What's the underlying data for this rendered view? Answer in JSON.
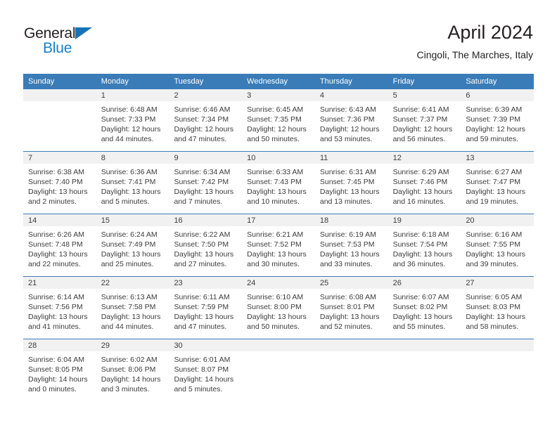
{
  "brand": {
    "word_one": "General",
    "word_two": "Blue",
    "triangle_color": "#1574b8",
    "blue_text_color": "#1b7fc4"
  },
  "header": {
    "title": "April 2024",
    "subtitle": "Cingoli, The Marches, Italy"
  },
  "theme": {
    "header_blue": "#3a7cb8",
    "day_band_gray": "#f1f1f1",
    "text_color": "#3c3c3c"
  },
  "weekdays": [
    "Sunday",
    "Monday",
    "Tuesday",
    "Wednesday",
    "Thursday",
    "Friday",
    "Saturday"
  ],
  "weeks": [
    [
      {
        "day": "",
        "sunrise": "",
        "sunset": "",
        "daylight_1": "",
        "daylight_2": ""
      },
      {
        "day": "1",
        "sunrise": "Sunrise: 6:48 AM",
        "sunset": "Sunset: 7:33 PM",
        "daylight_1": "Daylight: 12 hours",
        "daylight_2": "and 44 minutes."
      },
      {
        "day": "2",
        "sunrise": "Sunrise: 6:46 AM",
        "sunset": "Sunset: 7:34 PM",
        "daylight_1": "Daylight: 12 hours",
        "daylight_2": "and 47 minutes."
      },
      {
        "day": "3",
        "sunrise": "Sunrise: 6:45 AM",
        "sunset": "Sunset: 7:35 PM",
        "daylight_1": "Daylight: 12 hours",
        "daylight_2": "and 50 minutes."
      },
      {
        "day": "4",
        "sunrise": "Sunrise: 6:43 AM",
        "sunset": "Sunset: 7:36 PM",
        "daylight_1": "Daylight: 12 hours",
        "daylight_2": "and 53 minutes."
      },
      {
        "day": "5",
        "sunrise": "Sunrise: 6:41 AM",
        "sunset": "Sunset: 7:37 PM",
        "daylight_1": "Daylight: 12 hours",
        "daylight_2": "and 56 minutes."
      },
      {
        "day": "6",
        "sunrise": "Sunrise: 6:39 AM",
        "sunset": "Sunset: 7:39 PM",
        "daylight_1": "Daylight: 12 hours",
        "daylight_2": "and 59 minutes."
      }
    ],
    [
      {
        "day": "7",
        "sunrise": "Sunrise: 6:38 AM",
        "sunset": "Sunset: 7:40 PM",
        "daylight_1": "Daylight: 13 hours",
        "daylight_2": "and 2 minutes."
      },
      {
        "day": "8",
        "sunrise": "Sunrise: 6:36 AM",
        "sunset": "Sunset: 7:41 PM",
        "daylight_1": "Daylight: 13 hours",
        "daylight_2": "and 5 minutes."
      },
      {
        "day": "9",
        "sunrise": "Sunrise: 6:34 AM",
        "sunset": "Sunset: 7:42 PM",
        "daylight_1": "Daylight: 13 hours",
        "daylight_2": "and 7 minutes."
      },
      {
        "day": "10",
        "sunrise": "Sunrise: 6:33 AM",
        "sunset": "Sunset: 7:43 PM",
        "daylight_1": "Daylight: 13 hours",
        "daylight_2": "and 10 minutes."
      },
      {
        "day": "11",
        "sunrise": "Sunrise: 6:31 AM",
        "sunset": "Sunset: 7:45 PM",
        "daylight_1": "Daylight: 13 hours",
        "daylight_2": "and 13 minutes."
      },
      {
        "day": "12",
        "sunrise": "Sunrise: 6:29 AM",
        "sunset": "Sunset: 7:46 PM",
        "daylight_1": "Daylight: 13 hours",
        "daylight_2": "and 16 minutes."
      },
      {
        "day": "13",
        "sunrise": "Sunrise: 6:27 AM",
        "sunset": "Sunset: 7:47 PM",
        "daylight_1": "Daylight: 13 hours",
        "daylight_2": "and 19 minutes."
      }
    ],
    [
      {
        "day": "14",
        "sunrise": "Sunrise: 6:26 AM",
        "sunset": "Sunset: 7:48 PM",
        "daylight_1": "Daylight: 13 hours",
        "daylight_2": "and 22 minutes."
      },
      {
        "day": "15",
        "sunrise": "Sunrise: 6:24 AM",
        "sunset": "Sunset: 7:49 PM",
        "daylight_1": "Daylight: 13 hours",
        "daylight_2": "and 25 minutes."
      },
      {
        "day": "16",
        "sunrise": "Sunrise: 6:22 AM",
        "sunset": "Sunset: 7:50 PM",
        "daylight_1": "Daylight: 13 hours",
        "daylight_2": "and 27 minutes."
      },
      {
        "day": "17",
        "sunrise": "Sunrise: 6:21 AM",
        "sunset": "Sunset: 7:52 PM",
        "daylight_1": "Daylight: 13 hours",
        "daylight_2": "and 30 minutes."
      },
      {
        "day": "18",
        "sunrise": "Sunrise: 6:19 AM",
        "sunset": "Sunset: 7:53 PM",
        "daylight_1": "Daylight: 13 hours",
        "daylight_2": "and 33 minutes."
      },
      {
        "day": "19",
        "sunrise": "Sunrise: 6:18 AM",
        "sunset": "Sunset: 7:54 PM",
        "daylight_1": "Daylight: 13 hours",
        "daylight_2": "and 36 minutes."
      },
      {
        "day": "20",
        "sunrise": "Sunrise: 6:16 AM",
        "sunset": "Sunset: 7:55 PM",
        "daylight_1": "Daylight: 13 hours",
        "daylight_2": "and 39 minutes."
      }
    ],
    [
      {
        "day": "21",
        "sunrise": "Sunrise: 6:14 AM",
        "sunset": "Sunset: 7:56 PM",
        "daylight_1": "Daylight: 13 hours",
        "daylight_2": "and 41 minutes."
      },
      {
        "day": "22",
        "sunrise": "Sunrise: 6:13 AM",
        "sunset": "Sunset: 7:58 PM",
        "daylight_1": "Daylight: 13 hours",
        "daylight_2": "and 44 minutes."
      },
      {
        "day": "23",
        "sunrise": "Sunrise: 6:11 AM",
        "sunset": "Sunset: 7:59 PM",
        "daylight_1": "Daylight: 13 hours",
        "daylight_2": "and 47 minutes."
      },
      {
        "day": "24",
        "sunrise": "Sunrise: 6:10 AM",
        "sunset": "Sunset: 8:00 PM",
        "daylight_1": "Daylight: 13 hours",
        "daylight_2": "and 50 minutes."
      },
      {
        "day": "25",
        "sunrise": "Sunrise: 6:08 AM",
        "sunset": "Sunset: 8:01 PM",
        "daylight_1": "Daylight: 13 hours",
        "daylight_2": "and 52 minutes."
      },
      {
        "day": "26",
        "sunrise": "Sunrise: 6:07 AM",
        "sunset": "Sunset: 8:02 PM",
        "daylight_1": "Daylight: 13 hours",
        "daylight_2": "and 55 minutes."
      },
      {
        "day": "27",
        "sunrise": "Sunrise: 6:05 AM",
        "sunset": "Sunset: 8:03 PM",
        "daylight_1": "Daylight: 13 hours",
        "daylight_2": "and 58 minutes."
      }
    ],
    [
      {
        "day": "28",
        "sunrise": "Sunrise: 6:04 AM",
        "sunset": "Sunset: 8:05 PM",
        "daylight_1": "Daylight: 14 hours",
        "daylight_2": "and 0 minutes."
      },
      {
        "day": "29",
        "sunrise": "Sunrise: 6:02 AM",
        "sunset": "Sunset: 8:06 PM",
        "daylight_1": "Daylight: 14 hours",
        "daylight_2": "and 3 minutes."
      },
      {
        "day": "30",
        "sunrise": "Sunrise: 6:01 AM",
        "sunset": "Sunset: 8:07 PM",
        "daylight_1": "Daylight: 14 hours",
        "daylight_2": "and 5 minutes."
      },
      {
        "day": "",
        "sunrise": "",
        "sunset": "",
        "daylight_1": "",
        "daylight_2": ""
      },
      {
        "day": "",
        "sunrise": "",
        "sunset": "",
        "daylight_1": "",
        "daylight_2": ""
      },
      {
        "day": "",
        "sunrise": "",
        "sunset": "",
        "daylight_1": "",
        "daylight_2": ""
      },
      {
        "day": "",
        "sunrise": "",
        "sunset": "",
        "daylight_1": "",
        "daylight_2": ""
      }
    ]
  ]
}
